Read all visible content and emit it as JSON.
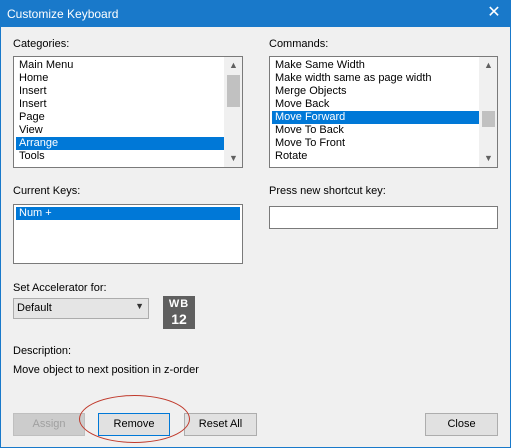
{
  "window": {
    "title": "Customize Keyboard",
    "close_glyph": "✕"
  },
  "categories": {
    "label": "Categories:",
    "items": [
      "Main Menu",
      "Home",
      "Insert",
      "Insert",
      "Page",
      "View",
      "Arrange",
      "Tools"
    ],
    "selected_index": 6
  },
  "commands": {
    "label": "Commands:",
    "items": [
      "Make Same Width",
      "Make width same as page width",
      "Merge Objects",
      "Move Back",
      "Move Forward",
      "Move To Back",
      "Move To Front",
      "Rotate"
    ],
    "selected_index": 4
  },
  "current_keys": {
    "label": "Current Keys:",
    "items": [
      "Num +"
    ]
  },
  "shortcut": {
    "label": "Press new shortcut key:",
    "value": ""
  },
  "accelerator": {
    "label": "Set Accelerator for:",
    "value": "Default"
  },
  "badge": {
    "line1": "WB",
    "line2": "12"
  },
  "description": {
    "label": "Description:",
    "text": "Move object to next position in z-order"
  },
  "buttons": {
    "assign": "Assign",
    "remove": "Remove",
    "reset_all": "Reset All",
    "close": "Close"
  },
  "colors": {
    "title_bar": "#1979ca",
    "selection": "#0078d7",
    "highlight_ellipse": "#c0392b"
  }
}
